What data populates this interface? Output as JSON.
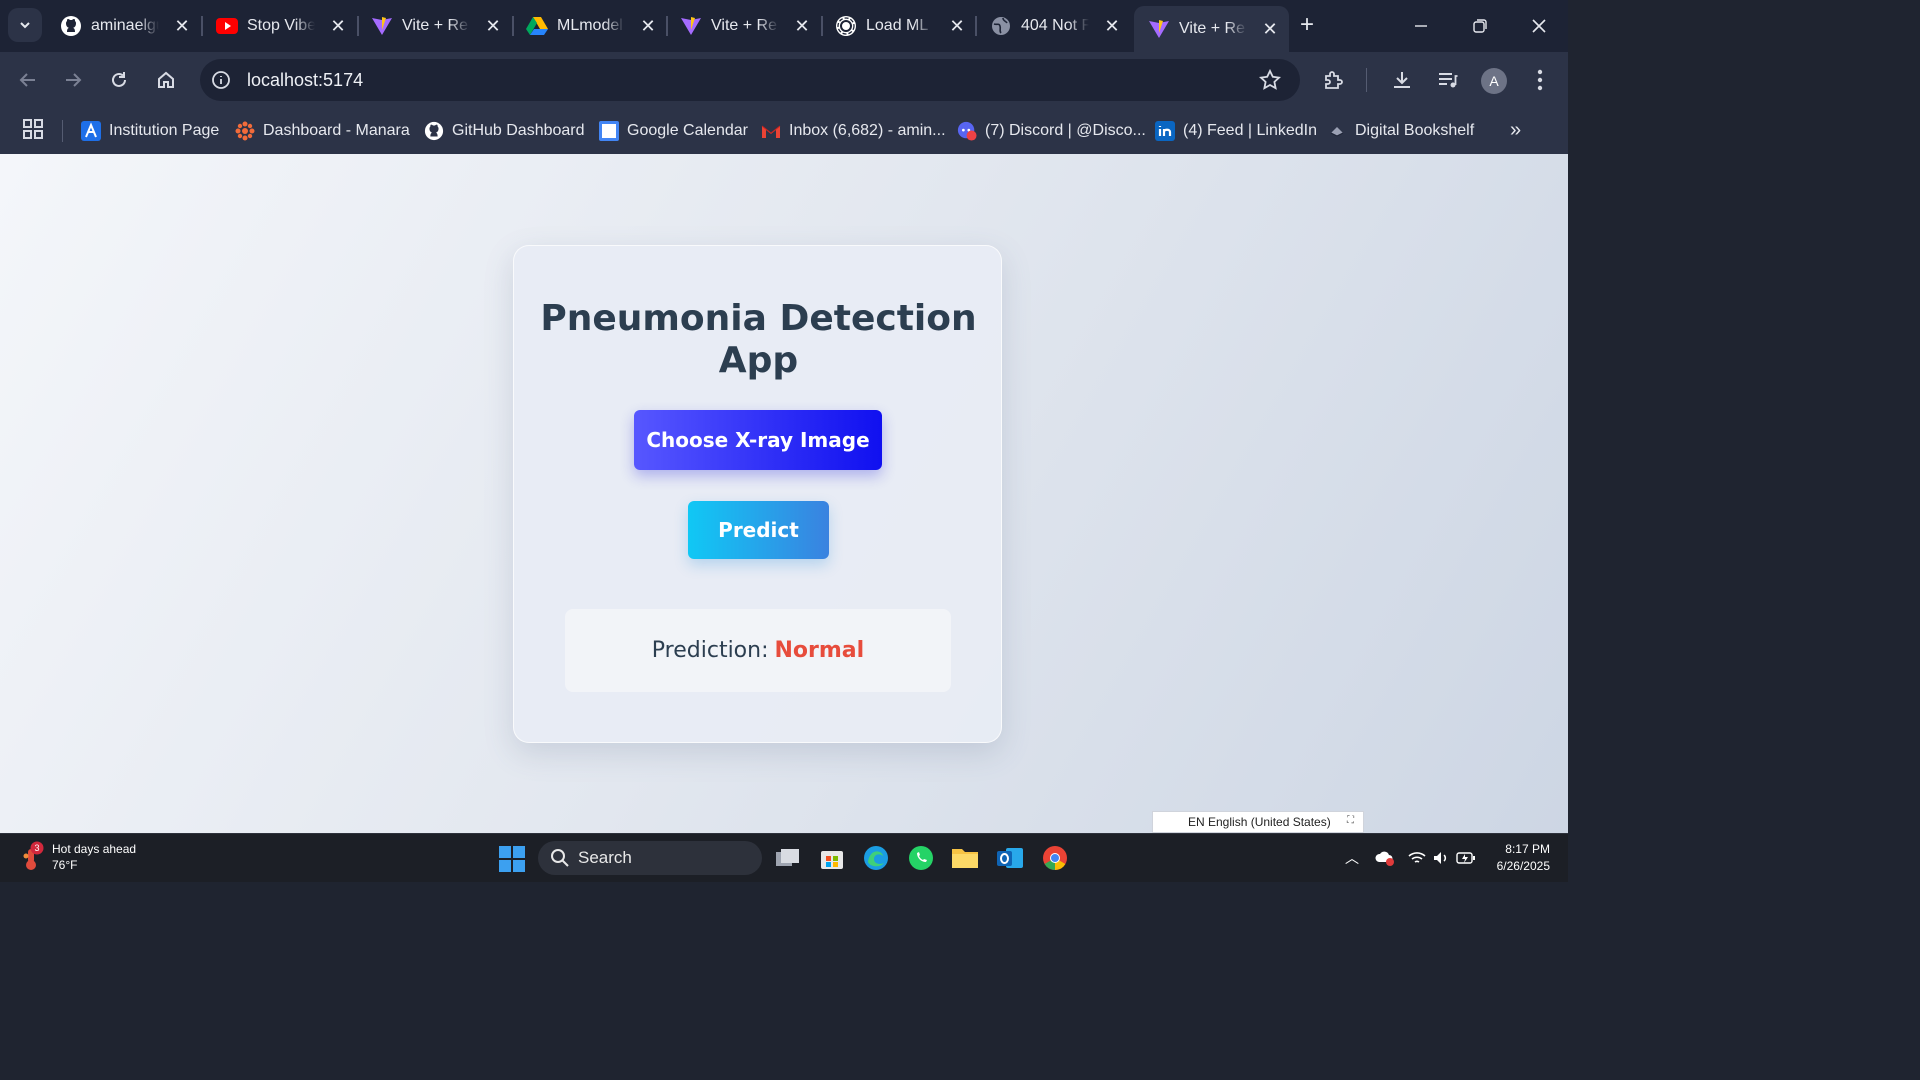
{
  "tabs": [
    {
      "title": "aminaelgu",
      "icon": "github-icon"
    },
    {
      "title": "Stop Vibe",
      "icon": "youtube-icon"
    },
    {
      "title": "Vite + Re",
      "icon": "vite-icon"
    },
    {
      "title": "MLmodel",
      "icon": "google-drive-icon"
    },
    {
      "title": "Vite + Re",
      "icon": "vite-icon"
    },
    {
      "title": "Load ML",
      "icon": "chatgpt-icon"
    },
    {
      "title": "404 Not F",
      "icon": "globe-icon"
    },
    {
      "title": "Vite + Re",
      "icon": "vite-icon",
      "active": true
    }
  ],
  "address_bar": {
    "url": "localhost:5174"
  },
  "profile": {
    "initial": "A"
  },
  "bookmarks": [
    {
      "label": "Institution Page",
      "icon": "institution-icon"
    },
    {
      "label": "Dashboard - Manara",
      "icon": "manara-icon"
    },
    {
      "label": "GitHub Dashboard",
      "icon": "github-icon"
    },
    {
      "label": "Google Calendar",
      "icon": "calendar-icon",
      "badge": "20"
    },
    {
      "label": "Inbox (6,682) - amin...",
      "icon": "gmail-icon"
    },
    {
      "label": "(7) Discord | @Disco...",
      "icon": "discord-icon",
      "badge": "4"
    },
    {
      "label": "(4) Feed | LinkedIn",
      "icon": "linkedin-icon"
    },
    {
      "label": "Digital Bookshelf",
      "icon": "bookshelf-icon"
    }
  ],
  "app": {
    "title": "Pneumonia Detection App",
    "choose_button": "Choose X-ray Image",
    "predict_button": "Predict",
    "prediction_label": "Prediction:",
    "prediction_value": "Normal"
  },
  "language_popup": {
    "text": "EN English (United States)"
  },
  "taskbar": {
    "weather_title": "Hot days ahead",
    "weather_temp": "76°F",
    "weather_badge": "3",
    "search_label": "Search",
    "time": "8:17 PM",
    "date": "6/26/2025"
  },
  "colors": {
    "prediction_value": "#e74c3c",
    "choose_button": "#1010f0",
    "predict_button": "#10c8f5"
  }
}
